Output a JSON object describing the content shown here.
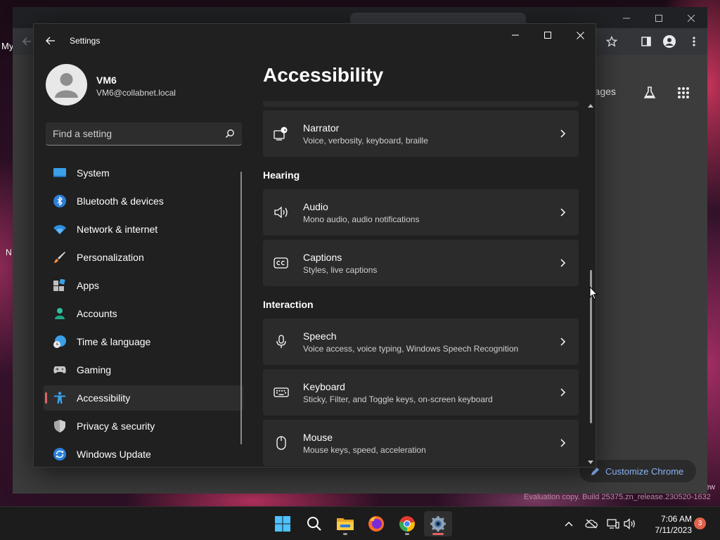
{
  "desktop": {
    "label_my": "My",
    "label_n": "N",
    "label_ew": "ew"
  },
  "chrome": {
    "images_link": "Images",
    "customize_label": "Customize Chrome"
  },
  "settings": {
    "app_title": "Settings",
    "profile": {
      "name": "VM6",
      "email": "VM6@collabnet.local"
    },
    "search": {
      "placeholder": "Find a setting",
      "value": ""
    },
    "nav": [
      {
        "label": "System",
        "icon": "monitor-icon"
      },
      {
        "label": "Bluetooth & devices",
        "icon": "bluetooth-icon"
      },
      {
        "label": "Network & internet",
        "icon": "wifi-icon"
      },
      {
        "label": "Personalization",
        "icon": "paintbrush-icon"
      },
      {
        "label": "Apps",
        "icon": "apps-icon"
      },
      {
        "label": "Accounts",
        "icon": "person-icon"
      },
      {
        "label": "Time & language",
        "icon": "globe-clock-icon"
      },
      {
        "label": "Gaming",
        "icon": "gamepad-icon"
      },
      {
        "label": "Accessibility",
        "icon": "accessibility-icon",
        "selected": true
      },
      {
        "label": "Privacy & security",
        "icon": "shield-icon"
      },
      {
        "label": "Windows Update",
        "icon": "update-icon"
      }
    ],
    "page_title": "Accessibility",
    "sections": [
      {
        "heading": "Hearing"
      },
      {
        "heading": "Interaction"
      }
    ],
    "cards": [
      {
        "title": "Narrator",
        "subtitle": "Voice, verbosity, keyboard, braille",
        "icon": "narrator-icon"
      },
      {
        "title": "Audio",
        "subtitle": "Mono audio, audio notifications",
        "icon": "speaker-icon"
      },
      {
        "title": "Captions",
        "subtitle": "Styles, live captions",
        "icon": "captions-icon"
      },
      {
        "title": "Speech",
        "subtitle": "Voice access, voice typing, Windows Speech Recognition",
        "icon": "microphone-icon"
      },
      {
        "title": "Keyboard",
        "subtitle": "Sticky, Filter, and Toggle keys, on-screen keyboard",
        "icon": "keyboard-icon"
      },
      {
        "title": "Mouse",
        "subtitle": "Mouse keys, speed, acceleration",
        "icon": "mouse-icon"
      }
    ]
  },
  "watermark": "Evaluation copy. Build 25375.zn_release.230520-1632",
  "taskbar": {
    "apps": [
      "start-icon",
      "search-icon",
      "file-explorer-icon",
      "firefox-icon",
      "chrome-icon",
      "settings-icon"
    ],
    "clock": {
      "time": "7:06 AM",
      "date": "7/11/2023"
    },
    "notification_count": "3"
  },
  "colors": {
    "accent": "#e06565",
    "settings_bg": "#202020",
    "card_bg": "#2b2b2b",
    "link_blue": "#8ab4f8"
  }
}
